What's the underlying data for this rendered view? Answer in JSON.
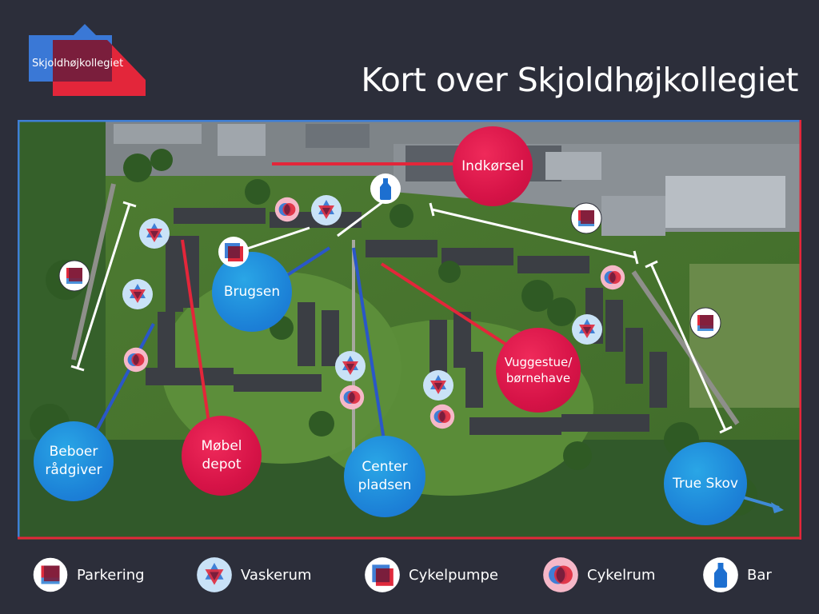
{
  "header": {
    "logo_text": "Skjoldhøjkollegiet",
    "title": "Kort over Skjoldhøjkollegiet"
  },
  "map": {
    "labels": {
      "indkorsel": "Indkørsel",
      "brugsen": "Brugsen",
      "vuggestue": "Vuggestue/\nbørnehave",
      "beboer": "Beboer\nrådgiver",
      "mobel": "Møbel\ndepot",
      "center": "Center\npladsen",
      "true_skov": "True Skov"
    }
  },
  "legend": {
    "parkering": "Parkering",
    "vaskerum": "Vaskerum",
    "cykelpumpe": "Cykelpumpe",
    "cykelrum": "Cykelrum",
    "bar": "Bar"
  },
  "colors": {
    "background": "#2c2e3a",
    "accent_blue": "#1d84d8",
    "accent_red": "#d61347",
    "border_blue": "#3f7fd6",
    "border_red": "#e3263a"
  },
  "icons": {
    "parkering": "parking-icon",
    "vaskerum": "laundry-star-icon",
    "cykelpumpe": "bike-pump-icon",
    "cykelrum": "bike-room-icon",
    "bar": "bottle-icon"
  }
}
